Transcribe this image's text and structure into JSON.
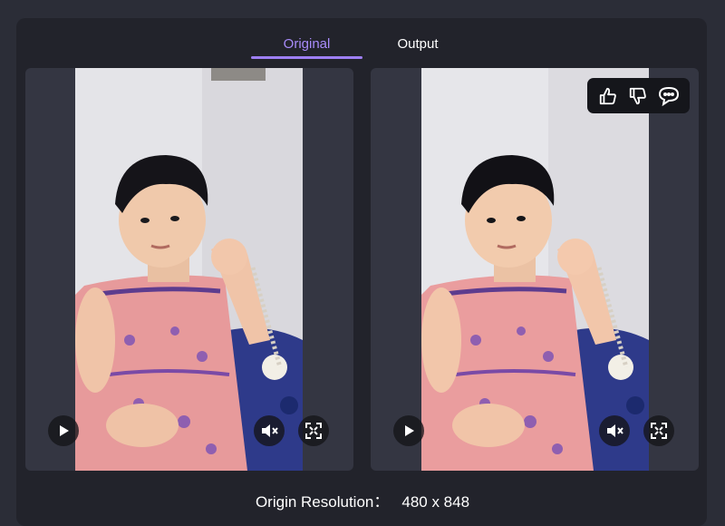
{
  "tabs": [
    {
      "label": "Original",
      "active": true
    },
    {
      "label": "Output",
      "active": false
    }
  ],
  "accent_color": "#a88bfa",
  "videos": [
    {
      "name": "original",
      "controls": [
        "play-icon",
        "mute-icon",
        "fullscreen-icon"
      ]
    },
    {
      "name": "output",
      "controls": [
        "play-icon",
        "mute-icon",
        "fullscreen-icon"
      ]
    }
  ],
  "feedback": {
    "icons": [
      "thumbs-up-icon",
      "thumbs-down-icon",
      "comment-icon"
    ]
  },
  "resolution": {
    "label": "Origin Resolution：",
    "value": "480 x 848"
  }
}
